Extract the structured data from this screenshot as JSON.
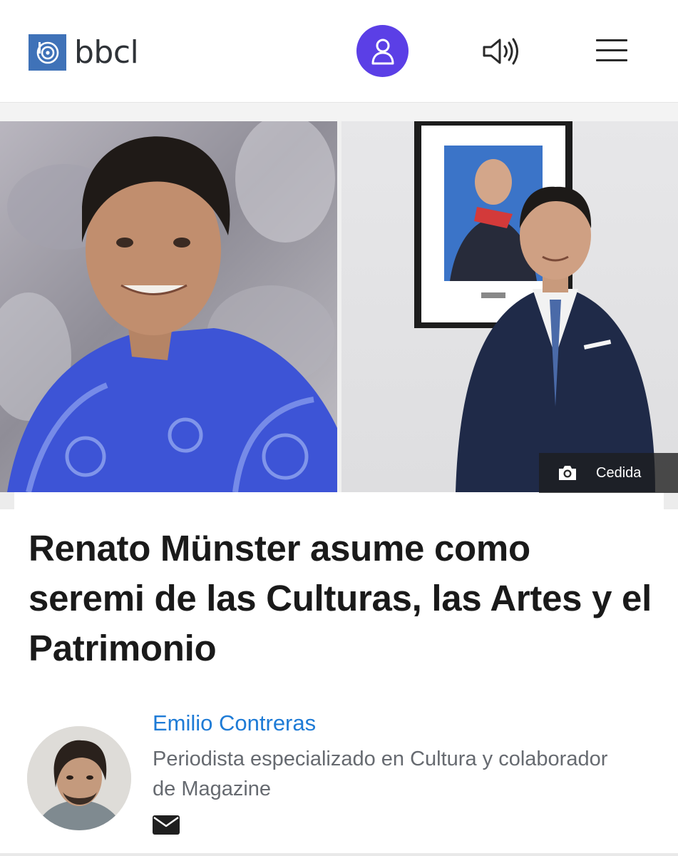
{
  "header": {
    "logo_text": "bbcl",
    "brand_color": "#3f72b8",
    "account_color": "#5b3fe6",
    "icons": [
      "logo-icon",
      "user-icon",
      "speaker-icon",
      "hamburger-menu-icon"
    ]
  },
  "hero": {
    "caption": "Cedida",
    "caption_icon": "camera-icon"
  },
  "article": {
    "title": "Renato Münster asume como seremi de las Culturas, las Artes y el Patrimonio"
  },
  "author": {
    "name": "Emilio Contreras",
    "role": "Periodista especializado en Cultura y colaborador de Magazine",
    "name_color": "#1e7bd6",
    "contact_icon": "mail-icon"
  }
}
